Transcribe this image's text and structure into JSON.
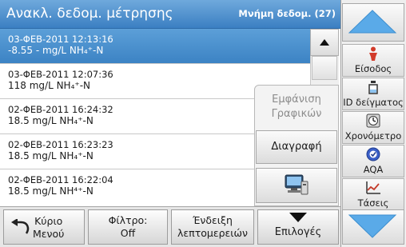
{
  "header": {
    "title": "Ανακλ. δεδομ. μέτρησης",
    "memory_label": "Μνήμη δεδομ. (27)"
  },
  "records": [
    {
      "line1": "03-ΦΕΒ-2011  12:13:16",
      "line2": "-8.55  -  mg/L  NH₄⁺-N",
      "selected": true
    },
    {
      "line1": "03-ΦΕΒ-2011  12:07:36",
      "line2": "118  mg/L  NH₄⁺-N",
      "selected": false
    },
    {
      "line1": "02-ΦΕΒ-2011  16:24:32",
      "line2": "18.5  mg/L  NH₄⁺-N",
      "selected": false
    },
    {
      "line1": "02-ΦΕΒ-2011  16:23:23",
      "line2": "18.5  mg/L  NH₄⁺-N",
      "selected": false
    },
    {
      "line1": "02-ΦΕΒ-2011  16:22:04",
      "line2": "18.5  mg/L  NH⁴⁺-N",
      "selected": false
    }
  ],
  "popup": {
    "show_graph_line1": "Εμφάνιση",
    "show_graph_line2": "Γραφικών",
    "delete_label": "Διαγραφή",
    "transfer_icon": "pc-transfer-icon"
  },
  "bottom": {
    "main_menu_line1": "Κύριο",
    "main_menu_line2": "Μενού",
    "filter_line1": "Φίλτρο:",
    "filter_line2": "Off",
    "details_line1": "Ένδειξη",
    "details_line2": "λεπτομερειών",
    "options_label": "Επιλογές"
  },
  "sidebar": {
    "tabs": [
      {
        "label": "Είσοδος",
        "icon": "person-icon"
      },
      {
        "label": "ID δείγματος",
        "icon": "bottle-icon"
      },
      {
        "label": "Χρονόμετρο",
        "icon": "timer-icon"
      },
      {
        "label": "AQA",
        "icon": "aqa-icon"
      },
      {
        "label": "Τάσεις",
        "icon": "trend-icon"
      }
    ]
  },
  "colors": {
    "accent": "#3b7fc2",
    "selected_row": "#4a90cf",
    "arrow": "#5aaae8",
    "person": "#d23b2a"
  }
}
